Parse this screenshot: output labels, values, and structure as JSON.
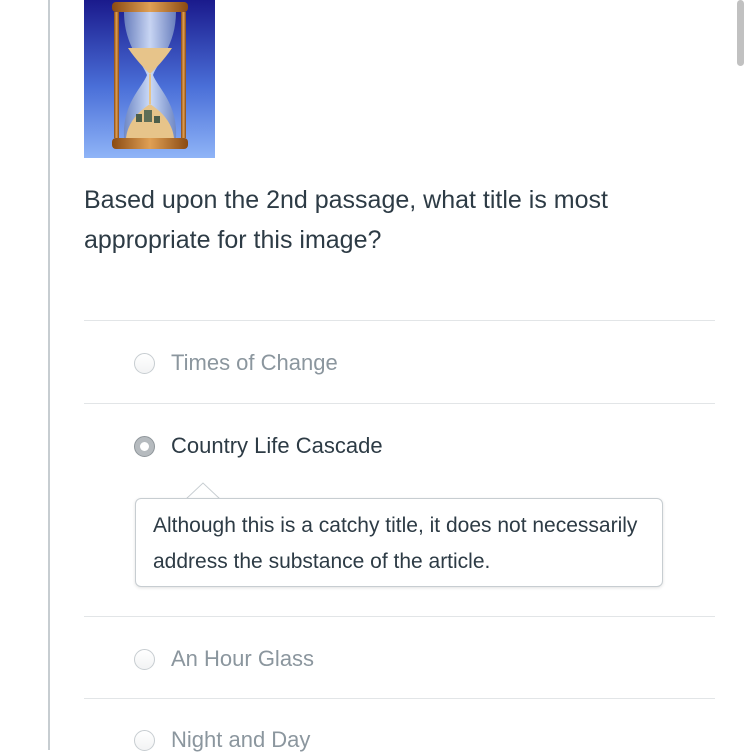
{
  "question": {
    "text": "Based upon the 2nd passage, what title is most appropriate for this image?",
    "image_alt": "hourglass"
  },
  "answers": [
    {
      "label": "Times of Change",
      "selected": false
    },
    {
      "label": "Country Life Cascade",
      "selected": true
    },
    {
      "label": "An Hour Glass",
      "selected": false
    },
    {
      "label": "Night and Day",
      "selected": false
    }
  ],
  "feedback": {
    "text": "Although this is a catchy title, it does not necessarily address the substance of the article."
  },
  "colors": {
    "text": "#2d3b45",
    "muted_text": "#8b969e",
    "border": "#c7cdd1",
    "divider": "#e2e5e7"
  },
  "icons": {
    "hourglass": "hourglass-image",
    "radio": "radio-button"
  }
}
